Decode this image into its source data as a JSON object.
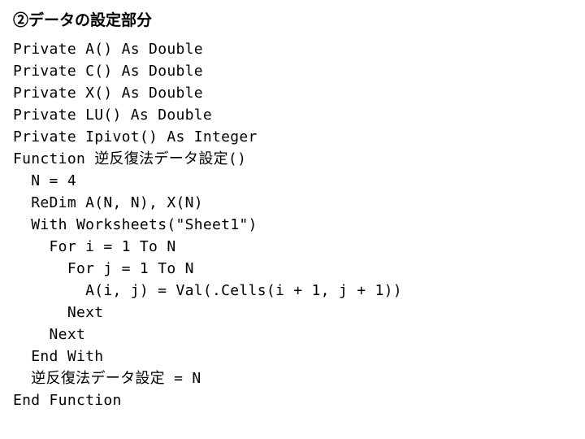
{
  "heading": " ②データの設定部分",
  "code": {
    "lines": [
      "Private A() As Double",
      "Private C() As Double",
      "Private X() As Double",
      "Private LU() As Double",
      "Private Ipivot() As Integer",
      "Function 逆反復法データ設定()",
      "  N = 4",
      "  ReDim A(N, N), X(N)",
      "  With Worksheets(\"Sheet1\")",
      "    For i = 1 To N",
      "      For j = 1 To N",
      "        A(i, j) = Val(.Cells(i + 1, j + 1))",
      "      Next",
      "    Next",
      "  End With",
      "  逆反復法データ設定 = N",
      "End Function"
    ]
  }
}
